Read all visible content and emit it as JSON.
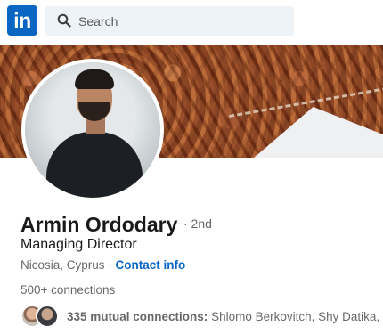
{
  "nav": {
    "logo_text": "in",
    "search_placeholder": "Search"
  },
  "profile": {
    "name": "Armin Ordodary",
    "degree": "· 2nd",
    "headline": "Managing Director",
    "location": "Nicosia, Cyprus ·",
    "contact_info": "Contact info",
    "connections": "500+ connections"
  },
  "mutual": {
    "count_label": "335 mutual connections:",
    "names": "Shlomo Berkovitch, Shy Datika, a"
  },
  "colors": {
    "brand": "#0a66c2",
    "search_bg": "#eef3f8"
  }
}
